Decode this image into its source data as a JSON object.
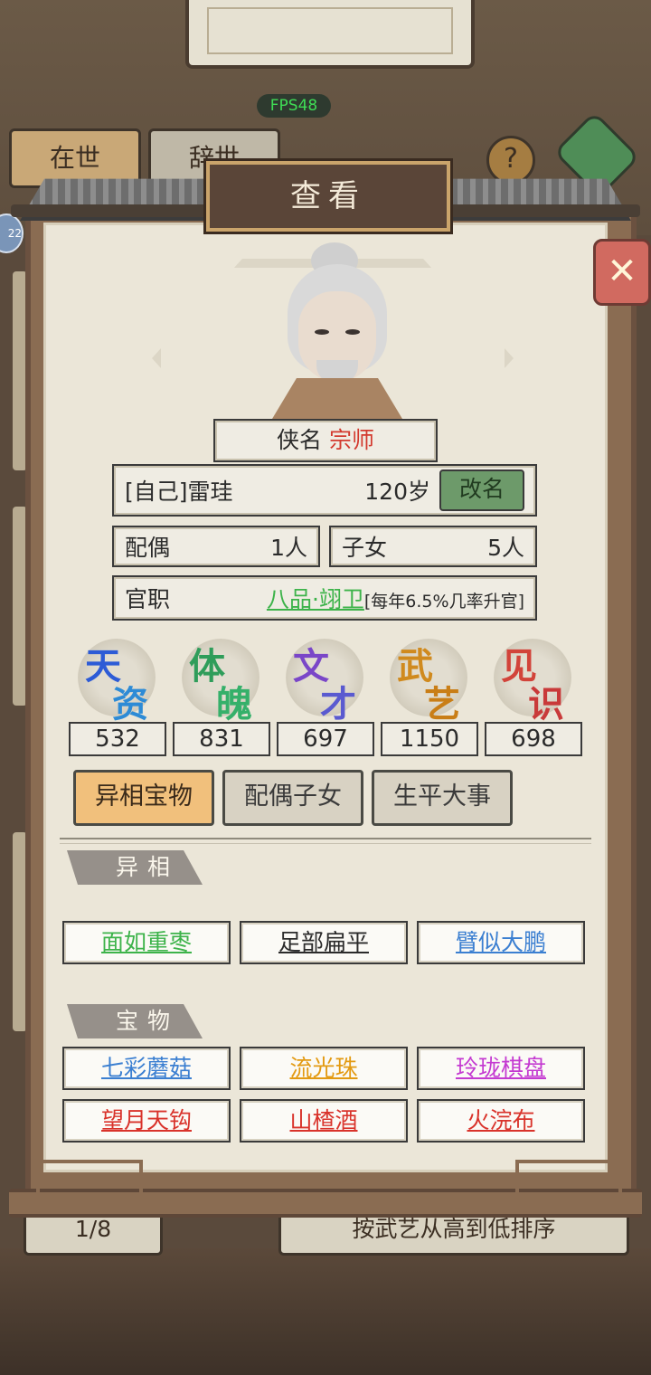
{
  "fps": "FPS48",
  "background_tabs": {
    "alive": "在世",
    "dead": "辞世",
    "help": "?"
  },
  "left_badge": "22",
  "title": "查看",
  "close_symbol": "✕",
  "hero": {
    "title_label": "侠名",
    "title_value": "宗师"
  },
  "identity": {
    "name": "[自己]雷珪",
    "age": "120岁",
    "rename_label": "改名"
  },
  "family": {
    "spouse_label": "配偶",
    "spouse_value": "1人",
    "children_label": "子女",
    "children_value": "5人"
  },
  "office": {
    "label": "官职",
    "rank": "八品·翊卫",
    "note": "[每年6.5%几率升官]"
  },
  "attributes": [
    {
      "c1": "天",
      "c2": "资",
      "value": "532",
      "color1": "#2d5bd6",
      "color2": "#2d8bd6"
    },
    {
      "c1": "体",
      "c2": "魄",
      "value": "831",
      "color1": "#2f9d5a",
      "color2": "#35b06a"
    },
    {
      "c1": "文",
      "c2": "才",
      "value": "697",
      "color1": "#7a46c8",
      "color2": "#5a5ad0"
    },
    {
      "c1": "武",
      "c2": "艺",
      "value": "1150",
      "color1": "#d08a1e",
      "color2": "#c97e17"
    },
    {
      "c1": "见",
      "c2": "识",
      "value": "698",
      "color1": "#d2433a",
      "color2": "#c93a3a"
    }
  ],
  "tabs": [
    {
      "label": "异相宝物",
      "active": true
    },
    {
      "label": "配偶子女",
      "active": false
    },
    {
      "label": "生平大事",
      "active": false
    }
  ],
  "sections": {
    "traits_title": "异相",
    "treasures_title": "宝物"
  },
  "traits": [
    {
      "label": "面如重枣",
      "color": "#3db34a"
    },
    {
      "label": "足部扁平",
      "color": "#2b2b2b"
    },
    {
      "label": "臂似大鹏",
      "color": "#3b7fd1"
    }
  ],
  "treasures": [
    {
      "label": "七彩蘑菇",
      "color": "#3b7fd1"
    },
    {
      "label": "流光珠",
      "color": "#e39a12"
    },
    {
      "label": "玲珑棋盘",
      "color": "#c43ad1"
    },
    {
      "label": "望月天钩",
      "color": "#d9332b"
    },
    {
      "label": "山楂酒",
      "color": "#d9332b"
    },
    {
      "label": "火浣布",
      "color": "#d9332b"
    }
  ],
  "below": {
    "page": "1/8",
    "sort": "按武艺从高到低排序"
  }
}
